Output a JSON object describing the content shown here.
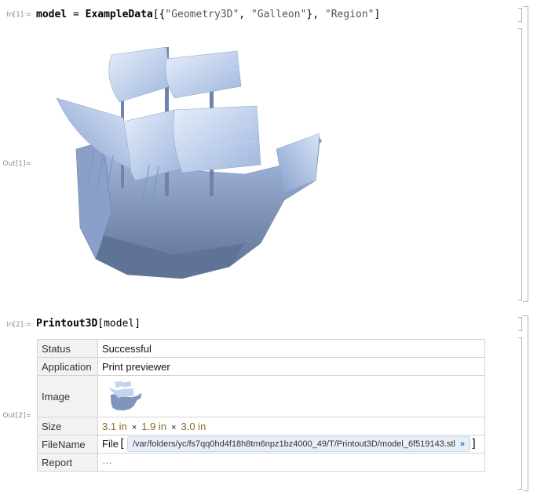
{
  "cell1": {
    "in_label": "In[1]:=",
    "out_label": "Out[1]=",
    "code_fn": "model",
    "code_eq": " = ",
    "code_call": "ExampleData",
    "code_open": "[{",
    "code_arg1": "\"Geometry3D\"",
    "code_sep1": ", ",
    "code_arg2": "\"Galleon\"",
    "code_close1": "}, ",
    "code_arg3": "\"Region\"",
    "code_close2": "]"
  },
  "cell2": {
    "in_label": "In[2]:=",
    "out_label": "Out[2]=",
    "code_call": "Printout3D",
    "code_open": "[",
    "code_arg": "model",
    "code_close": "]"
  },
  "result": {
    "rows": {
      "status": {
        "key": "Status",
        "value": "Successful"
      },
      "application": {
        "key": "Application",
        "value": "Print previewer"
      },
      "image": {
        "key": "Image"
      },
      "size": {
        "key": "Size",
        "v1": "3.1 in",
        "times": "×",
        "v2": "1.9 in",
        "v3": "3.0 in"
      },
      "filename": {
        "key": "FileName",
        "prefix": "File",
        "path": "/var/folders/yc/fs7qq0hd4f18h8tm6npz1bz4000_49/T/Printout3D/model_6f519143.stl",
        "chevron": "»"
      },
      "report": {
        "key": "Report",
        "value": "···"
      }
    }
  },
  "colors": {
    "model_light": "#b7c9ea",
    "model_dark": "#5e7396"
  }
}
